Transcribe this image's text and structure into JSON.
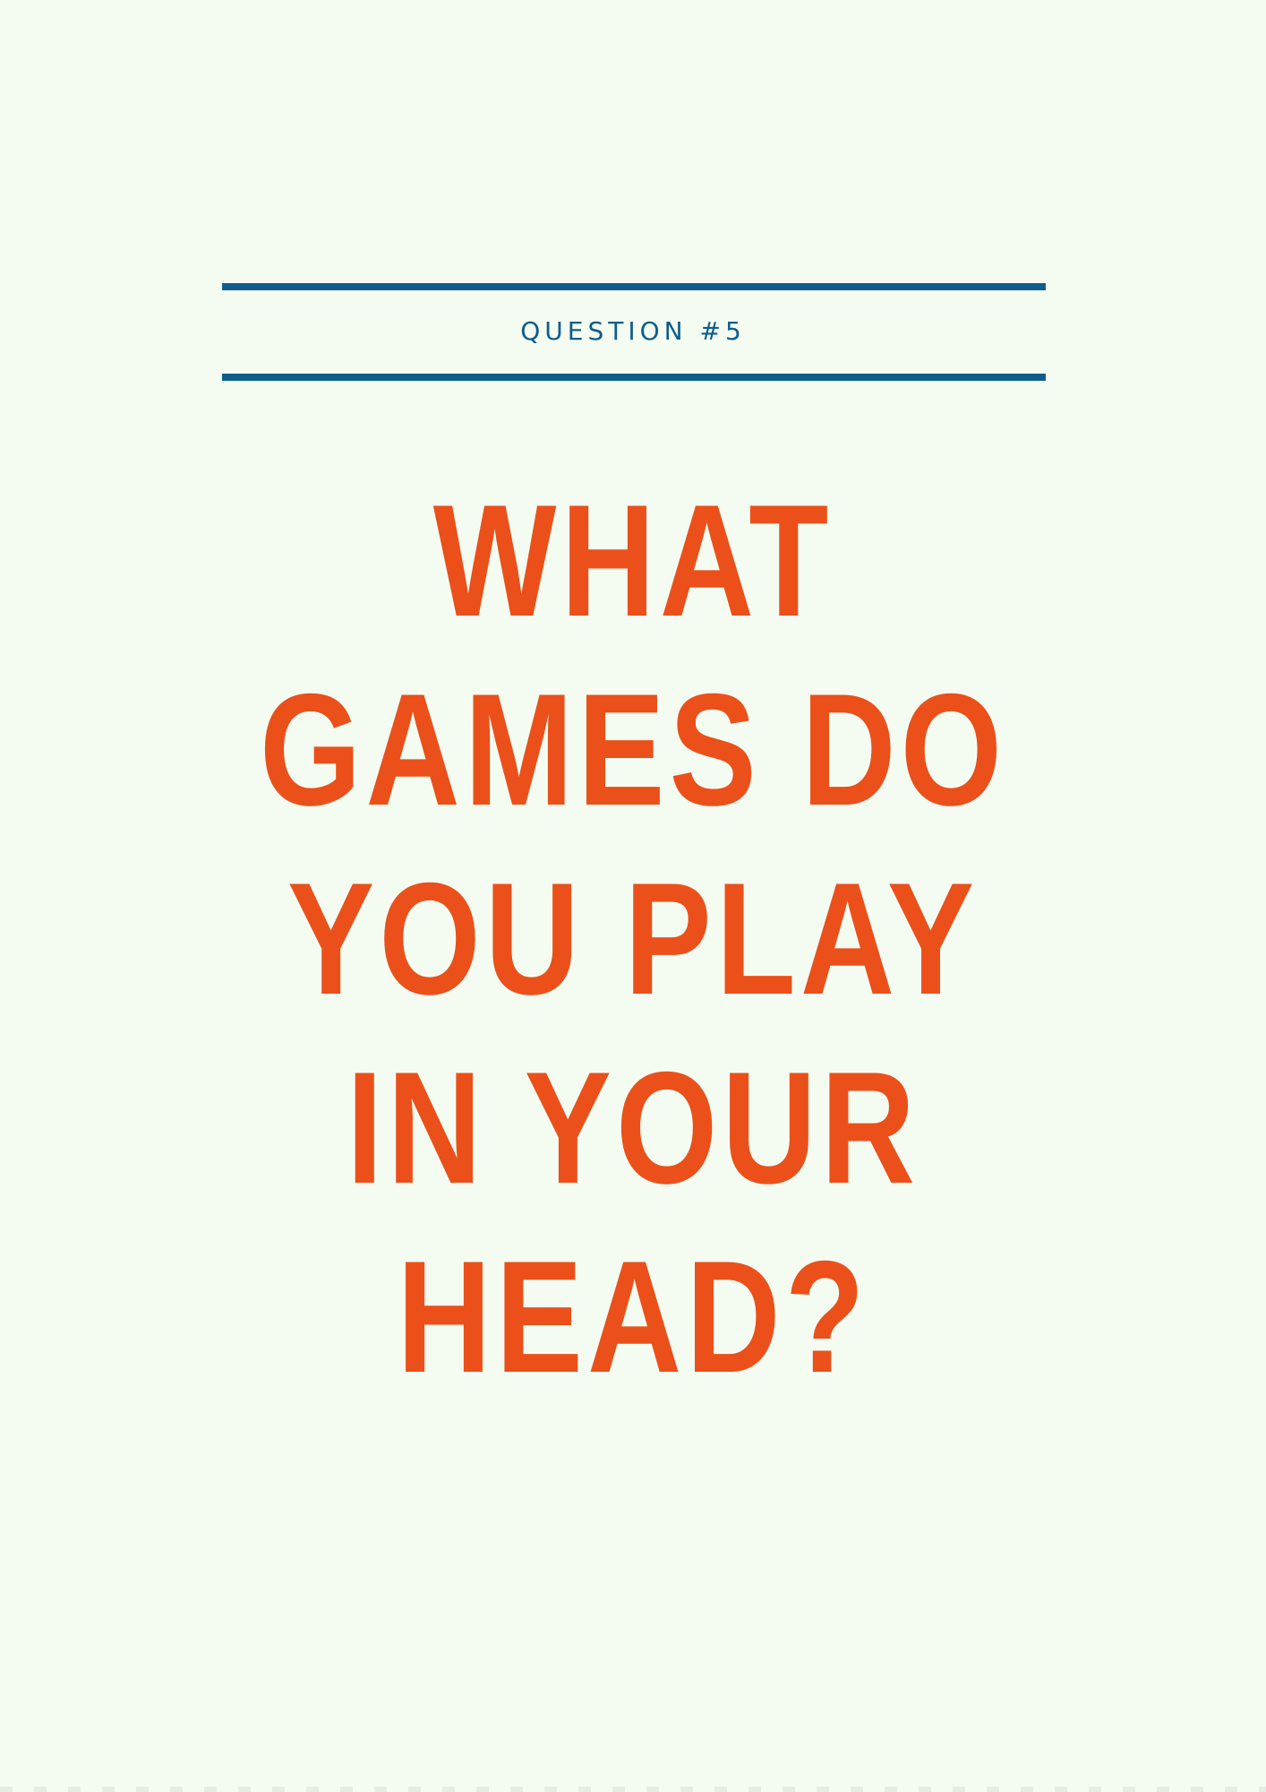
{
  "header": {
    "label": "QUESTION #5"
  },
  "question": {
    "lines": [
      "WHAT",
      "GAMES DO",
      "YOU PLAY",
      "IN YOUR",
      "HEAD?"
    ]
  },
  "colors": {
    "background": "#f4fcf2",
    "rule": "#0d5d8c",
    "label": "#0d5d8c",
    "question": "#eb501a"
  }
}
